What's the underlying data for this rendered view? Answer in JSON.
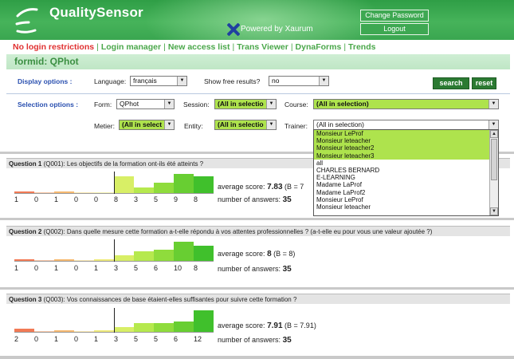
{
  "header": {
    "brand": "QualitySensor",
    "powered_by": "Powered by Xaurum",
    "change_password": "Change Password",
    "logout": "Logout"
  },
  "nav": {
    "items": [
      "No login restrictions",
      "Login manager",
      "New access list",
      "Trans Viewer",
      "DynaForms",
      "Trends"
    ],
    "active_color": "#e03030",
    "color": "#4aa74a"
  },
  "formid": "formid: QPhot",
  "display": {
    "label": "Display options :",
    "language_label": "Language:",
    "language_value": "français",
    "free_label": "Show free results?",
    "free_value": "no",
    "search": "search",
    "reset": "reset"
  },
  "selection": {
    "label": "Selection options :",
    "form_label": "Form:",
    "form_value": "QPhot",
    "session_label": "Session:",
    "session_value": "(All in selectio",
    "course_label": "Course:",
    "course_value": "(All in selection)",
    "metier_label": "Metier:",
    "metier_value": "(All in select",
    "entity_label": "Entity:",
    "entity_value": "(All in selectio",
    "trainer_label": "Trainer:",
    "trainer_value": "(All in selection)"
  },
  "dropdown": {
    "items": [
      {
        "label": "Monsieur LeProf",
        "selected": true
      },
      {
        "label": "Monsieur leteacher",
        "selected": true
      },
      {
        "label": "Monsieur leteacher2",
        "selected": true
      },
      {
        "label": "Monsieur leteacher3",
        "selected": true
      },
      {
        "label": "all",
        "selected": false
      },
      {
        "label": "CHARLES BERNARD",
        "selected": false
      },
      {
        "label": "E-LEARNING",
        "selected": false
      },
      {
        "label": "Madame LaProf",
        "selected": false
      },
      {
        "label": "Madame LaProf2",
        "selected": false
      },
      {
        "label": "Monsieur LeProf",
        "selected": false
      },
      {
        "label": "Monsieur leteacher",
        "selected": false
      }
    ]
  },
  "questions": [
    {
      "title_prefix": "Question 1",
      "title_rest": "(Q001): Les objectifs de la formation ont-ils été atteints ?",
      "counts": [
        1,
        0,
        1,
        0,
        0,
        8,
        3,
        5,
        9,
        8
      ],
      "score_label": "average score:",
      "score_value": "7.83",
      "score_extra": "(B = 7",
      "answers_label": "number of answers:",
      "answers_value": "35"
    },
    {
      "title_prefix": "Question 2",
      "title_rest": "(Q002): Dans quelle mesure cette formation a-t-elle répondu à vos attentes professionnelles ? (a-t-elle eu pour vous une valeur ajoutée ?)",
      "counts": [
        1,
        0,
        1,
        0,
        1,
        3,
        5,
        6,
        10,
        8
      ],
      "score_label": "average score:",
      "score_value": "8",
      "score_extra": "(B = 8)",
      "answers_label": "number of answers:",
      "answers_value": "35"
    },
    {
      "title_prefix": "Question 3",
      "title_rest": "(Q003): Vos connaissances de base étaient-elles suffisantes pour suivre cette formation ?",
      "counts": [
        2,
        0,
        1,
        0,
        1,
        3,
        5,
        5,
        6,
        12
      ],
      "score_label": "average score:",
      "score_value": "7.91",
      "score_extra": "(B = 7.91)",
      "answers_label": "number of answers:",
      "answers_value": "35"
    }
  ],
  "bar_colors": [
    "#f27a55",
    "#f49a62",
    "#f6b970",
    "#f5d77a",
    "#eeea7a",
    "#d8ef66",
    "#b6e94e",
    "#8fdc3c",
    "#68ce32",
    "#40c02c"
  ]
}
